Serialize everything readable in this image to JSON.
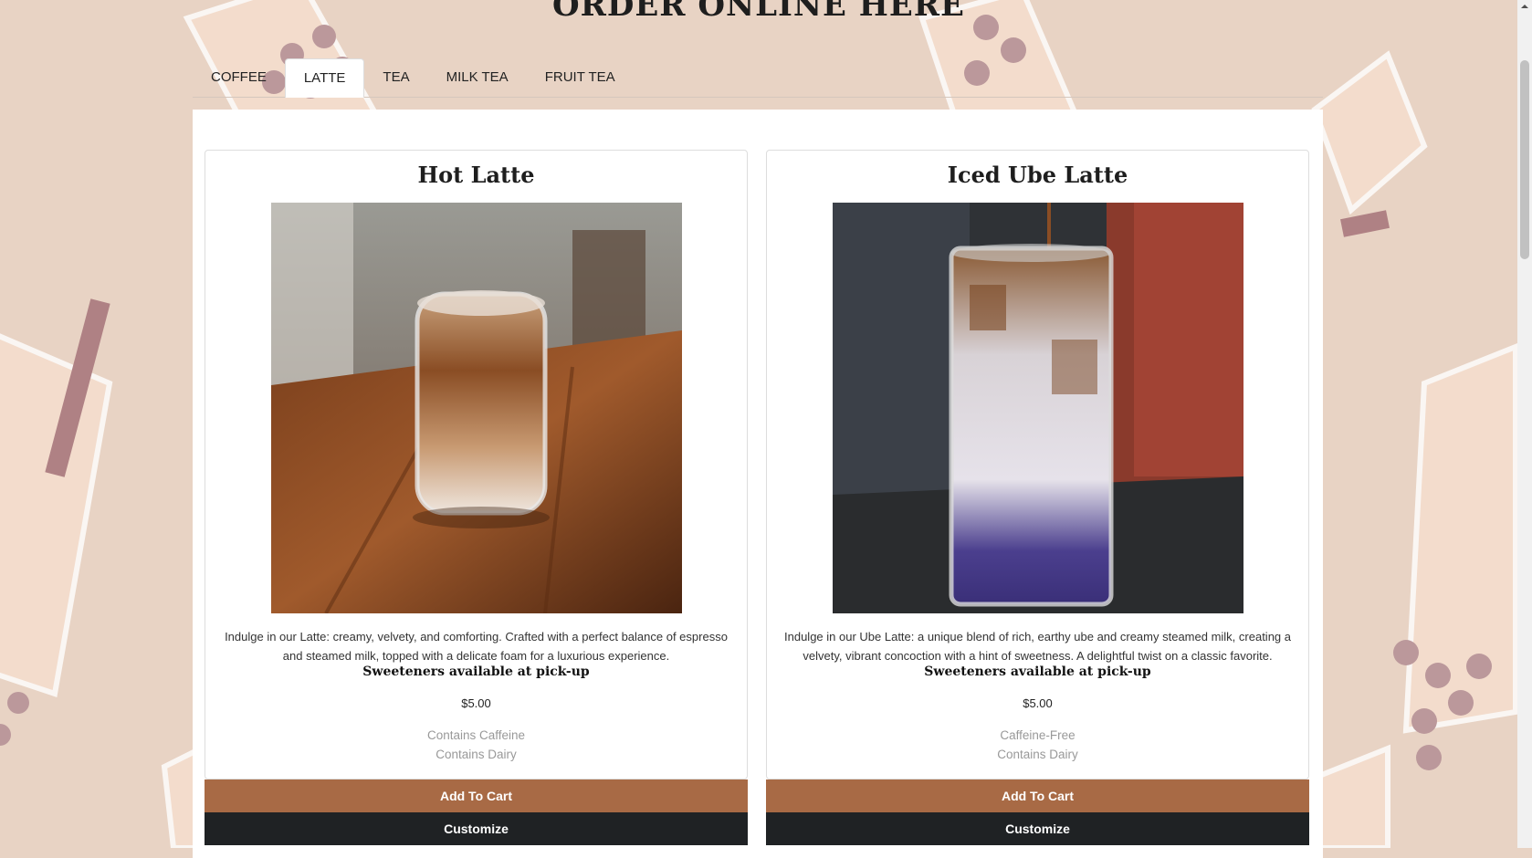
{
  "page": {
    "heading": "ORDER ONLINE HERE"
  },
  "tabs": [
    {
      "label": "COFFEE",
      "active": false
    },
    {
      "label": "LATTE",
      "active": true
    },
    {
      "label": "TEA",
      "active": false
    },
    {
      "label": "MILK TEA",
      "active": false
    },
    {
      "label": "FRUIT TEA",
      "active": false
    }
  ],
  "products": [
    {
      "title": "Hot Latte",
      "description": "Indulge in our Latte: creamy, velvety, and comforting. Crafted with a perfect balance of espresso and steamed milk, topped with a delicate foam for a luxurious experience.",
      "sweeteners": "Sweeteners available at pick-up",
      "price": "$5.00",
      "tag1": "Contains Caffeine",
      "tag2": "Contains Dairy",
      "add_label": "Add To Cart",
      "customize_label": "Customize"
    },
    {
      "title": "Iced Ube Latte",
      "description": "Indulge in our Ube Latte: a unique blend of rich, earthy ube and creamy steamed milk, creating a velvety, vibrant concoction with a hint of sweetness. A delightful twist on a classic favorite.",
      "sweeteners": "Sweeteners available at pick-up",
      "price": "$5.00",
      "tag1": "Caffeine-Free",
      "tag2": "Contains Dairy",
      "add_label": "Add To Cart",
      "customize_label": "Customize"
    }
  ],
  "colors": {
    "background": "#e8d3c4",
    "add_button": "#a86a45",
    "customize_button": "#1f2224"
  }
}
